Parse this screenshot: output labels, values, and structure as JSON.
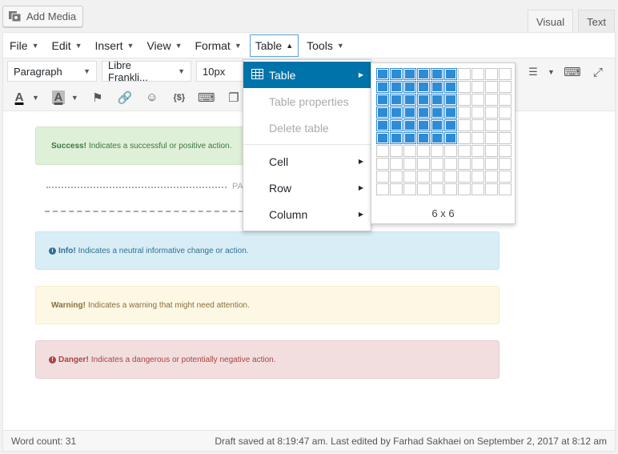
{
  "add_media": {
    "label": "Add Media"
  },
  "editor_tabs": [
    {
      "label": "Visual",
      "active": true
    },
    {
      "label": "Text",
      "active": false
    }
  ],
  "menubar": [
    {
      "label": "File"
    },
    {
      "label": "Edit"
    },
    {
      "label": "Insert"
    },
    {
      "label": "View"
    },
    {
      "label": "Format"
    },
    {
      "label": "Table"
    },
    {
      "label": "Tools"
    }
  ],
  "toolbar": {
    "format_select": "Paragraph",
    "font_select": "Libre Frankli...",
    "size_select": "10px"
  },
  "table_menu": {
    "items": [
      {
        "label": "Table"
      },
      {
        "label": "Table properties"
      },
      {
        "label": "Delete table"
      },
      {
        "label": "Cell"
      },
      {
        "label": "Row"
      },
      {
        "label": "Column"
      }
    ],
    "grid_selection": "6 x 6",
    "grid_rows_selected": 6,
    "grid_cols_selected": 6,
    "grid_size": 10,
    "accent": "#0073aa",
    "cell_color": "#2e8bd6"
  },
  "content": {
    "page_break_label": "PA",
    "alerts": {
      "success": {
        "strong": "Success!",
        "text": "Indicates a successful or positive action."
      },
      "info": {
        "icon": "i",
        "strong": "Info!",
        "text": "Indicates a neutral informative change or action."
      },
      "warning": {
        "strong": "Warning!",
        "text": "Indicates a warning that might need attention."
      },
      "danger": {
        "icon": "!",
        "strong": "Danger!",
        "text": "Indicates a dangerous or potentially negative action."
      }
    }
  },
  "status": {
    "word_count": "Word count: 31",
    "draft": "Draft saved at 8:19:47 am. Last edited by Farhad Sakhaei on September 2, 2017 at 8:12 am"
  }
}
